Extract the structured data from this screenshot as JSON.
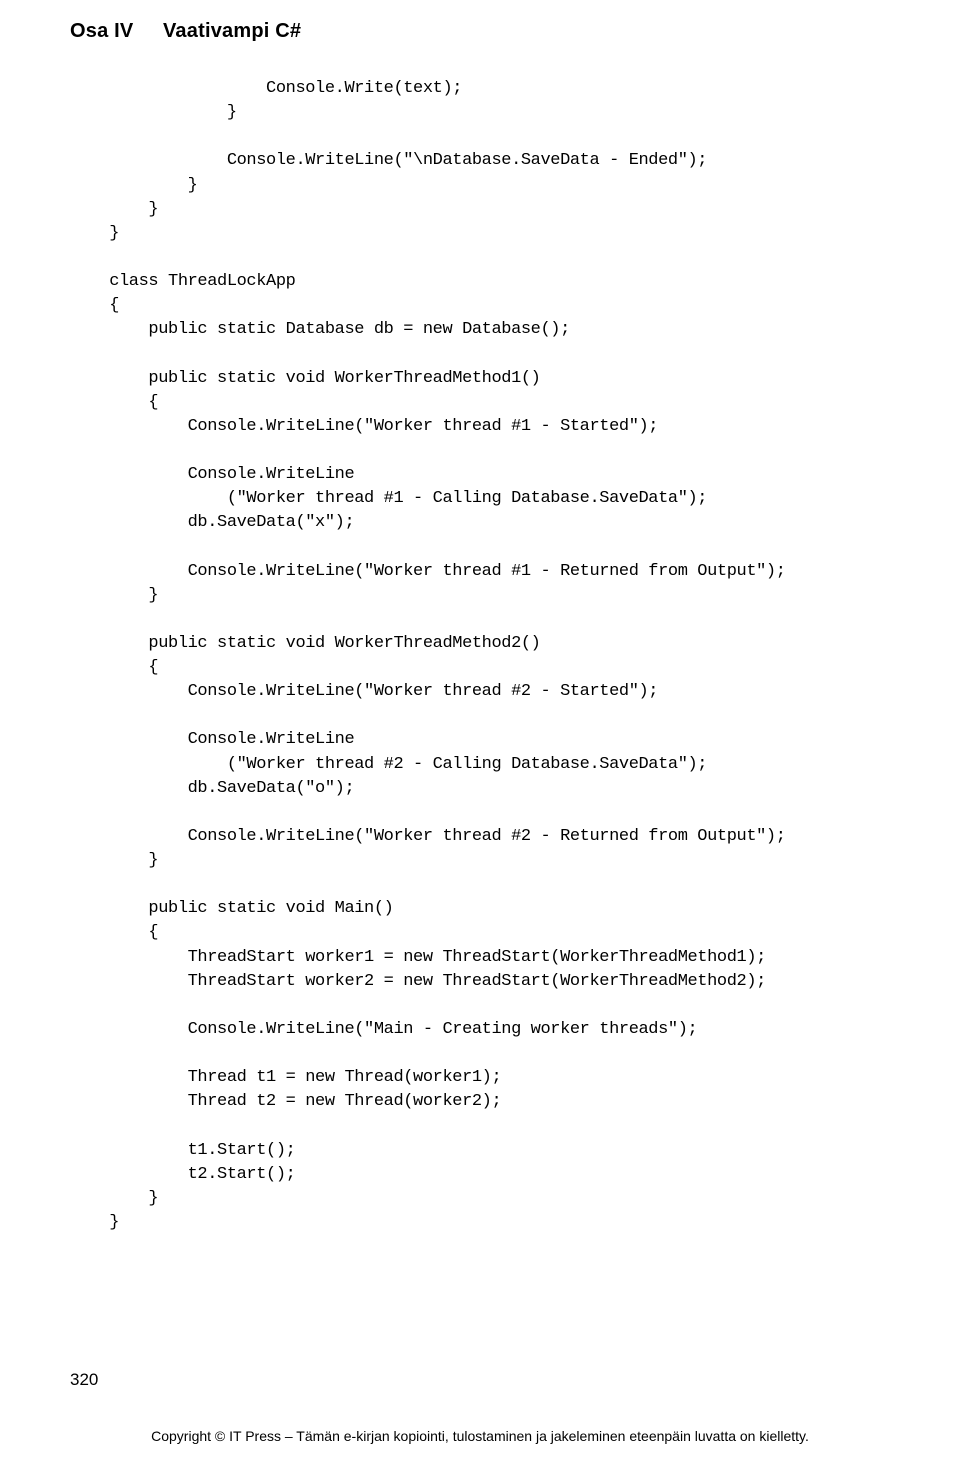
{
  "header": {
    "part": "Osa IV",
    "title": "Vaativampi C#"
  },
  "code": "                    Console.Write(text);\n                }\n\n                Console.WriteLine(\"\\nDatabase.SaveData - Ended\");\n            }\n        }\n    }\n\n    class ThreadLockApp\n    {\n        public static Database db = new Database();\n\n        public static void WorkerThreadMethod1()\n        {\n            Console.WriteLine(\"Worker thread #1 - Started\");\n\n            Console.WriteLine\n                (\"Worker thread #1 - Calling Database.SaveData\");\n            db.SaveData(\"x\");\n\n            Console.WriteLine(\"Worker thread #1 - Returned from Output\");\n        }\n\n        public static void WorkerThreadMethod2()\n        {\n            Console.WriteLine(\"Worker thread #2 - Started\");\n\n            Console.WriteLine\n                (\"Worker thread #2 - Calling Database.SaveData\");\n            db.SaveData(\"o\");\n\n            Console.WriteLine(\"Worker thread #2 - Returned from Output\");\n        }\n\n        public static void Main()\n        {\n            ThreadStart worker1 = new ThreadStart(WorkerThreadMethod1);\n            ThreadStart worker2 = new ThreadStart(WorkerThreadMethod2);\n\n            Console.WriteLine(\"Main - Creating worker threads\");\n\n            Thread t1 = new Thread(worker1);\n            Thread t2 = new Thread(worker2);\n\n            t1.Start();\n            t2.Start();\n        }\n    }",
  "footer": {
    "page_number": "320",
    "copyright": "Copyright © IT Press – Tämän e-kirjan kopiointi, tulostaminen ja jakeleminen eteenpäin luvatta on kielletty."
  }
}
